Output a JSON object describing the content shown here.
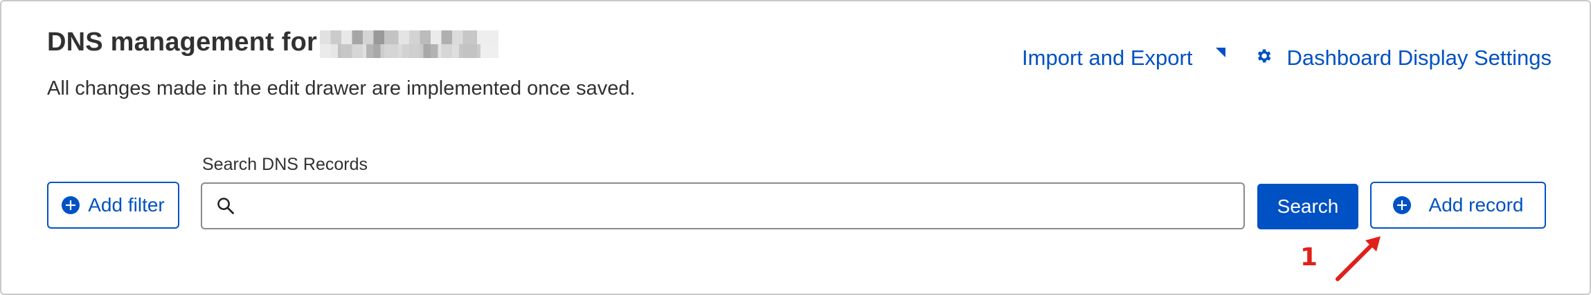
{
  "header": {
    "title": "DNS management for",
    "subtitle": "All changes made in the edit drawer are implemented once saved.",
    "import_export_label": "Import and Export",
    "display_settings_label": "Dashboard Display Settings"
  },
  "search": {
    "label": "Search DNS Records",
    "value": "",
    "button_label": "Search"
  },
  "actions": {
    "add_filter_label": "Add filter",
    "add_record_label": "Add record"
  },
  "annotation": {
    "number": "1"
  },
  "icons": {
    "search": "magnifier-icon",
    "plus": "plus-circle-icon",
    "gear": "gear-icon",
    "caret": "corner-caret-icon"
  },
  "colors": {
    "accent": "#0051c3",
    "text": "#313131",
    "annotation": "#e0201b"
  }
}
